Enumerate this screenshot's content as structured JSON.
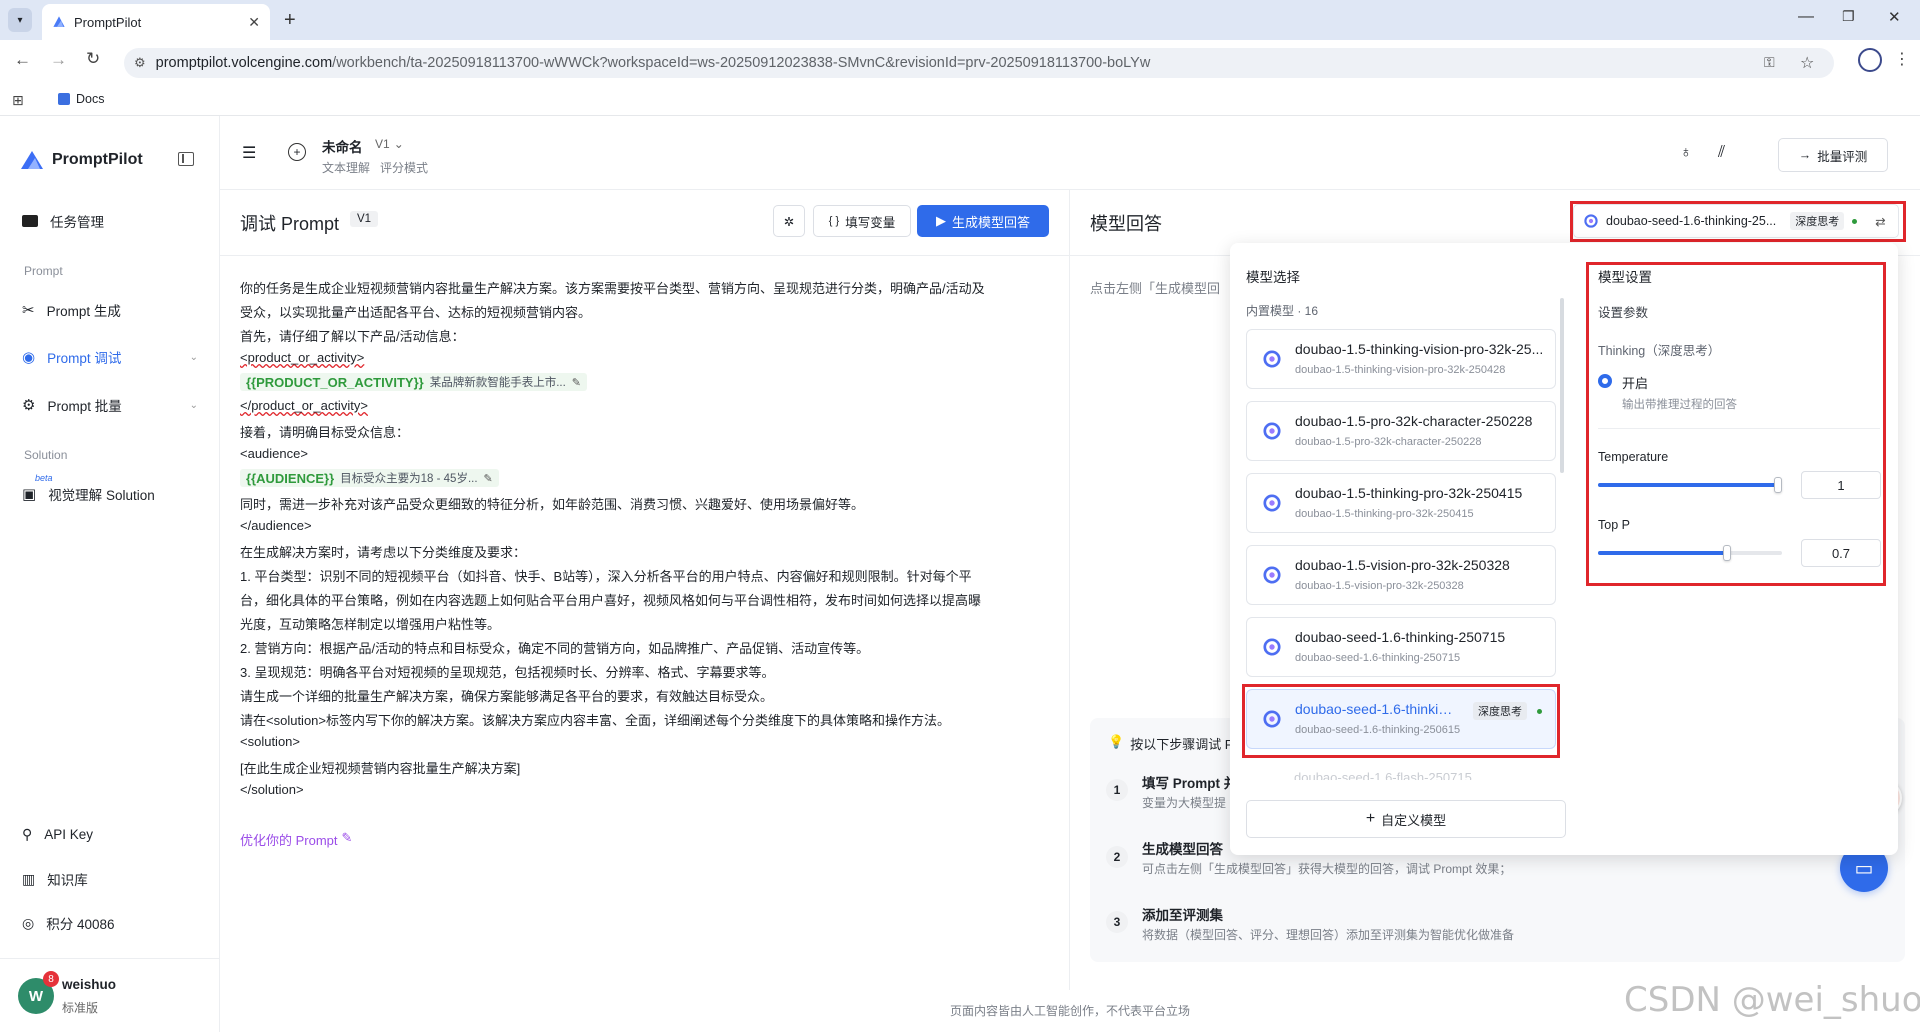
{
  "browser": {
    "tab_title": "PromptPilot",
    "url_host": "promptpilot.volcengine.com",
    "url_path": "/workbench/ta-20250918113700-wWWCk?workspaceId=ws-20250912023838-SMvnC&revisionId=prv-20250918113700-boLYw",
    "bookmark": "Docs"
  },
  "sidebar": {
    "brand": "PromptPilot",
    "task_mgmt": "任务管理",
    "section_prompt": "Prompt",
    "prompt_gen": "Prompt 生成",
    "prompt_debug": "Prompt 调试",
    "prompt_batch": "Prompt 批量",
    "section_solution": "Solution",
    "beta": "beta",
    "vision_solution": "视觉理解 Solution",
    "api_key": "API Key",
    "knowledge": "知识库",
    "points": "积分 40086",
    "user_initial": "W",
    "user_badge": "8",
    "user_name": "weishuo",
    "user_plan": "标准版"
  },
  "header": {
    "task_name": "未命名",
    "version": "V1",
    "tag1": "文本理解",
    "tag2": "评分模式",
    "batch_eval": "批量评测"
  },
  "debug": {
    "title": "调试 Prompt",
    "version": "V1",
    "fill_vars": "填写变量",
    "generate": "生成模型回答",
    "lines": [
      "你的任务是生成企业短视频营销内容批量生产解决方案。该方案需要按平台类型、营销方向、呈现规范进行分类，明确产品/活动及",
      "受众，以实现批量产出适配各平台、达标的短视频营销内容。",
      "首先，请仔细了解以下产品/活动信息：",
      "<product_or_activity>"
    ],
    "var1_name": "{{PRODUCT_OR_ACTIVITY}}",
    "var1_value": "某品牌新款智能手表上市...",
    "lines2": [
      "</product_or_activity>",
      "接着，请明确目标受众信息：",
      "<audience>"
    ],
    "var2_name": "{{AUDIENCE}}",
    "var2_value": "目标受众主要为18 - 45岁...",
    "lines3": [
      "同时，需进一步补充对该产品受众更细致的特征分析，如年龄范围、消费习惯、兴趣爱好、使用场景偏好等。",
      "</audience>",
      "在生成解决方案时，请考虑以下分类维度及要求：",
      "1. 平台类型：识别不同的短视频平台（如抖音、快手、B站等），深入分析各平台的用户特点、内容偏好和规则限制。针对每个平",
      "台，细化具体的平台策略，例如在内容选题上如何贴合平台用户喜好，视频风格如何与平台调性相符，发布时间如何选择以提高曝",
      "光度，互动策略怎样制定以增强用户粘性等。",
      "2. 营销方向：根据产品/活动的特点和目标受众，确定不同的营销方向，如品牌推广、产品促销、活动宣传等。",
      "3. 呈现规范：明确各平台对短视频的呈现规范，包括视频时长、分辨率、格式、字幕要求等。",
      "请生成一个详细的批量生产解决方案，确保方案能够满足各平台的要求，有效触达目标受众。",
      "请在<solution>标签内写下你的解决方案。该解决方案应内容丰富、全面，详细阐述每个分类维度下的具体策略和操作方法。",
      "<solution>",
      "[在此生成企业短视频营销内容批量生产解决方案]",
      "</solution>"
    ],
    "optimize": "优化你的 Prompt"
  },
  "response": {
    "title": "模型回答",
    "selected_model": "doubao-seed-1.6-thinking-25...",
    "deep_think": "深度思考",
    "hint_prefix": "点击左侧「生成模型回",
    "steps_title_prefix": "按以下步骤调试 P",
    "step1_title": "填写 Prompt 并",
    "step1_desc": "变量为大模型提",
    "step2_title": "生成模型回答",
    "step2_desc": "可点击左侧「生成模型回答」获得大模型的回答，调试 Prompt 效果；",
    "step3_title": "添加至评测集",
    "step3_desc": "将数据（模型回答、评分、理想回答）添加至评测集为智能优化做准备",
    "footer": "页面内容皆由人工智能创作，不代表平台立场"
  },
  "model_select": {
    "title": "模型选择",
    "subtitle": "内置模型 · 16",
    "models": [
      {
        "name": "doubao-1.5-thinking-vision-pro-32k-25...",
        "id": "doubao-1.5-thinking-vision-pro-32k-250428"
      },
      {
        "name": "doubao-1.5-pro-32k-character-250228",
        "id": "doubao-1.5-pro-32k-character-250228"
      },
      {
        "name": "doubao-1.5-thinking-pro-32k-250415",
        "id": "doubao-1.5-thinking-pro-32k-250415"
      },
      {
        "name": "doubao-1.5-vision-pro-32k-250328",
        "id": "doubao-1.5-vision-pro-32k-250328"
      },
      {
        "name": "doubao-seed-1.6-thinking-250715",
        "id": "doubao-seed-1.6-thinking-250715"
      },
      {
        "name": "doubao-seed-1.6-thinking...",
        "id": "doubao-seed-1.6-thinking-250615",
        "badge": "深度思考"
      }
    ],
    "partial_next": "doubao-seed-1.6-flash-250715",
    "custom": "自定义模型"
  },
  "model_settings": {
    "title": "模型设置",
    "section": "设置参数",
    "thinking_label": "Thinking（深度思考）",
    "thinking_on": "开启",
    "thinking_desc": "输出带推理过程的回答",
    "temperature_label": "Temperature",
    "temperature_value": "1",
    "temperature_fraction": 1.0,
    "top_p_label": "Top P",
    "top_p_value": "0.7",
    "top_p_fraction": 0.7
  },
  "watermark": "CSDN @wei_shuo",
  "colors": {
    "accent": "#2f6bea",
    "var_green": "#2f9a3c",
    "highlight": "#e0262b"
  }
}
